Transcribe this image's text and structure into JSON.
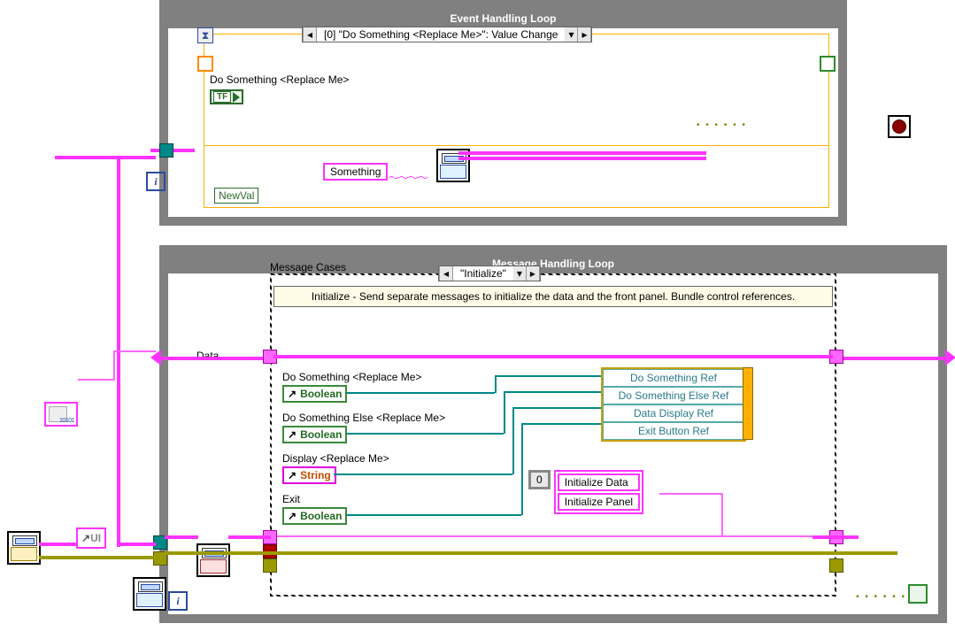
{
  "loops": {
    "event": {
      "title": "Event Handling Loop",
      "selector": "[0] \"Do Something <Replace Me>\": Value Change",
      "control_label": "Do Something <Replace Me>",
      "terminal_type": "TF",
      "const_something": "Something",
      "newval": "NewVal"
    },
    "message": {
      "title": "Message Handling Loop",
      "case_label": "Message Cases",
      "selector": "\"Initialize\"",
      "comment": "Initialize - Send separate messages to initialize the data and the front panel.  Bundle control references.",
      "data_tunnel": "Data",
      "refs": [
        {
          "label": "Do Something <Replace Me>",
          "type": "Boolean"
        },
        {
          "label": "Do Something Else <Replace Me>",
          "type": "Boolean"
        },
        {
          "label": "Display <Replace Me>",
          "type": "String"
        },
        {
          "label": "Exit",
          "type": "Boolean"
        }
      ],
      "bundle_items": [
        "Do Something Ref",
        "Do Something Else Ref",
        "Data Display Ref",
        "Exit Button Ref"
      ],
      "array_idx": "0",
      "array_items": [
        "Initialize Data",
        "Initialize Panel"
      ]
    }
  },
  "outer": {
    "ui_const": "UI"
  }
}
